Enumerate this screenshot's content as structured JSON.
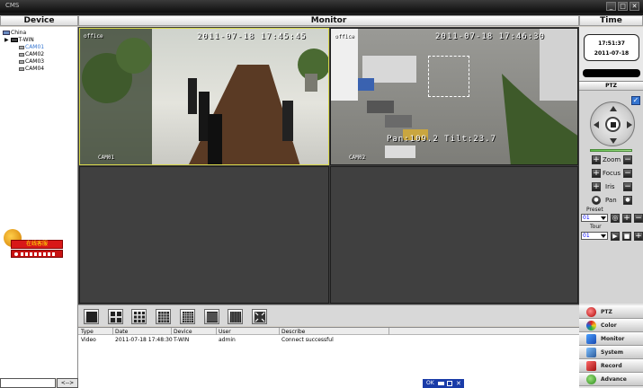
{
  "window": {
    "title": "CMS",
    "min": "_",
    "max": "□",
    "close": "✕"
  },
  "headers": {
    "device": "Device",
    "monitor": "Monitor",
    "time": "Time"
  },
  "device_tree": {
    "root": "China",
    "node": "T-WIN",
    "cams": [
      "CAM01",
      "CAM02",
      "CAM03",
      "CAM04"
    ],
    "selected": "CAM01"
  },
  "monitor": {
    "cam1": {
      "label": "CAM01",
      "osd_title": "office",
      "timestamp": "2011-07-18 17:45:45"
    },
    "cam2": {
      "label": "CAM02",
      "osd_title": "office",
      "timestamp": "2011-07-18 17:46:30",
      "ptz_readout": "Pan:109.2  Tilt:23.7"
    }
  },
  "time": {
    "clock": "17:51:37",
    "date": "2011-07-18"
  },
  "ptz": {
    "title": "PTZ",
    "zoom": "Zoom",
    "focus": "Focus",
    "iris": "Iris",
    "pan": "Pan",
    "preset_label": "Preset",
    "preset_value": "01",
    "tour_label": "Tour",
    "tour_value": "01"
  },
  "menu": [
    "PTZ",
    "Color",
    "Monitor",
    "System",
    "Record",
    "Advance"
  ],
  "log": {
    "columns": [
      "Type",
      "Date",
      "Device",
      "User",
      "Describe"
    ],
    "rows": [
      [
        "Video",
        "2011-07-18 17:48:30",
        "T-WIN",
        "admin",
        "Connect successful"
      ]
    ]
  },
  "widget": {
    "qq_text": "在线客服"
  },
  "bottom": {
    "nav": "<-->",
    "ok": "OK"
  },
  "colors": {
    "accent": "#3575d0",
    "black": "#000000",
    "panel": "#d4d0c8"
  }
}
